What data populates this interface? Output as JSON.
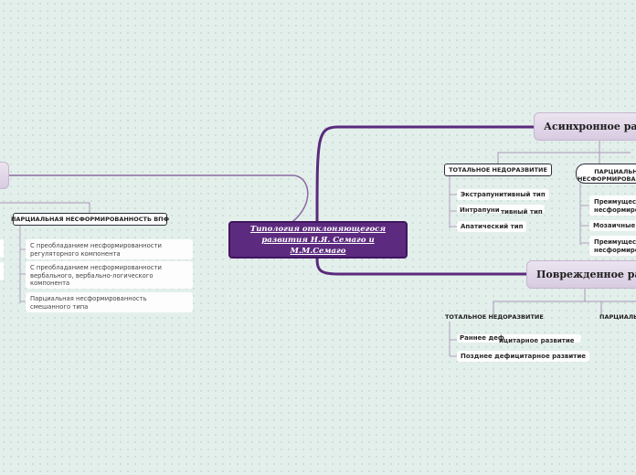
{
  "central": "Типология отклоняющегося развития Н.Я. Семаго и М.М.Семаго",
  "branches": {
    "asynchronous": {
      "title": "Асинхронное развитие",
      "total": {
        "label_left": "ТОТАЛЬНОЕ НЕД",
        "label_right": "ОРАЗВИТИЕ",
        "items": [
          "Экстрапунитивный тип",
          {
            "left": "Интрапуни",
            "right": "тивный тип"
          },
          "Апатический тип"
        ]
      },
      "partial": {
        "label": "ПАРЦИАЛЬНАЯ НЕСФОРМИРОВАННОСТЬ",
        "items": [
          "Преимущественная несформированность когнитивного компонента",
          "Мозаичные",
          "Преимущественная несформированность эмоционального компонента"
        ]
      }
    },
    "damaged": {
      "title": "Поврежденное развитие",
      "total": {
        "label_left": "ТОТАЛЬНОЕ НЕДО",
        "label_right": "РАЗВИТИЕ",
        "items": [
          {
            "left": "Раннее деф",
            "right": "ицитарное развитие"
          },
          "Позднее дефицитарное развитие"
        ]
      },
      "partial": {
        "label": "ПАРЦИАЛЬНОЕ"
      }
    },
    "left": {
      "partial": {
        "label": "ПАРЦИАЛЬНАЯ НЕСФОРМИРОВАННОСТЬ ВПФ",
        "items": [
          "С преобладанием несформированности регуляторного компонента",
          "С преобладанием несформированности вербального, вербально-логического компонента",
          "Парциальная несформированность смешанного типа"
        ]
      }
    }
  },
  "colors": {
    "central_bg": "#5c2a7e",
    "branch_line": "#5a2a7c",
    "connector": "#a796b8",
    "background": "#e3efea"
  }
}
